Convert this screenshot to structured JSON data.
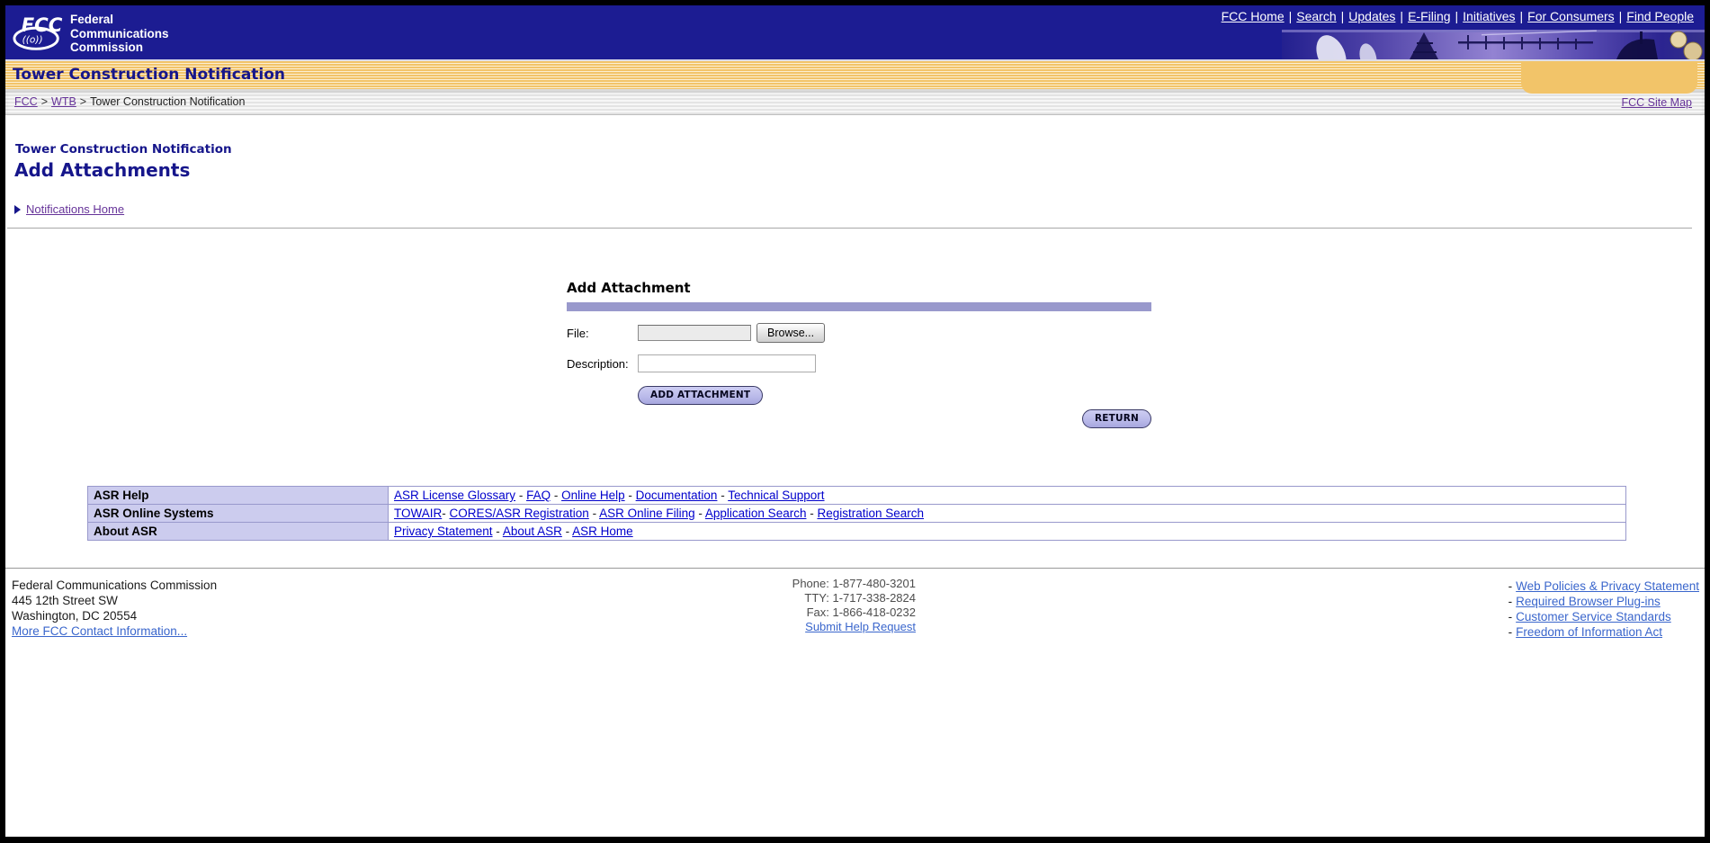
{
  "colors": {
    "header_navy": "#1C1C92",
    "banner_gold": "#F2C469",
    "banner_stripe": "#FCEFD2",
    "heading_blue": "#16168B",
    "accent_lavender": "#9999CC",
    "table_label_bg": "#CCCCEE",
    "link_blue": "#0000CC",
    "link_purple": "#663399",
    "footer_link_blue": "#3A66CC",
    "pill_fill": "#B9B9E9"
  },
  "header": {
    "logo_fcc": "FCC",
    "logo_waves": "((o))",
    "logo_lines": [
      "Federal",
      "Communications",
      "Commission"
    ],
    "nav_separator": "|",
    "nav_links": [
      "FCC Home",
      "Search",
      "Updates",
      "E-Filing",
      "Initiatives",
      "For Consumers",
      "Find People"
    ],
    "banner_title": "Tower Construction Notification"
  },
  "breadcrumb": {
    "link1": "FCC",
    "link2": "WTB",
    "separator": ">",
    "current": "Tower Construction Notification",
    "site_map_link": "FCC Site Map"
  },
  "page": {
    "subtitle": "Tower Construction Notification",
    "title": "Add Attachments",
    "home_link": "Notifications Home"
  },
  "form": {
    "title": "Add Attachment",
    "file_label": "File:",
    "file_value": "",
    "browse_button": "Browse...",
    "description_label": "Description:",
    "description_value": "",
    "add_button": "ADD ATTACHMENT",
    "return_button": "RETURN"
  },
  "help_table": {
    "rows": [
      {
        "label": "ASR Help",
        "links": [
          "ASR License Glossary",
          "FAQ",
          "Online Help",
          "Documentation",
          "Technical Support"
        ],
        "separators": [
          " - ",
          " - ",
          " - ",
          " - "
        ]
      },
      {
        "label": "ASR Online Systems",
        "links": [
          "TOWAIR",
          "CORES/ASR Registration",
          "ASR Online Filing",
          "Application Search",
          "Registration Search"
        ],
        "separators": [
          "- ",
          " - ",
          " - ",
          " - "
        ]
      },
      {
        "label": "About ASR",
        "links": [
          "Privacy Statement",
          "About ASR",
          "ASR Home"
        ],
        "separators": [
          " - ",
          " - "
        ]
      }
    ]
  },
  "footer": {
    "address_lines": [
      "Federal Communications Commission",
      "445 12th Street SW",
      "Washington, DC 20554"
    ],
    "contact_link": "More FCC Contact Information...",
    "phone": "Phone: 1-877-480-3201",
    "tty": "TTY: 1-717-338-2824",
    "fax": "Fax: 1-866-418-0232",
    "help_link": "Submit Help Request",
    "policy_prefix": "-",
    "policy_links": [
      "Web Policies & Privacy Statement",
      "Required Browser Plug-ins",
      "Customer Service Standards",
      "Freedom of Information Act"
    ]
  }
}
